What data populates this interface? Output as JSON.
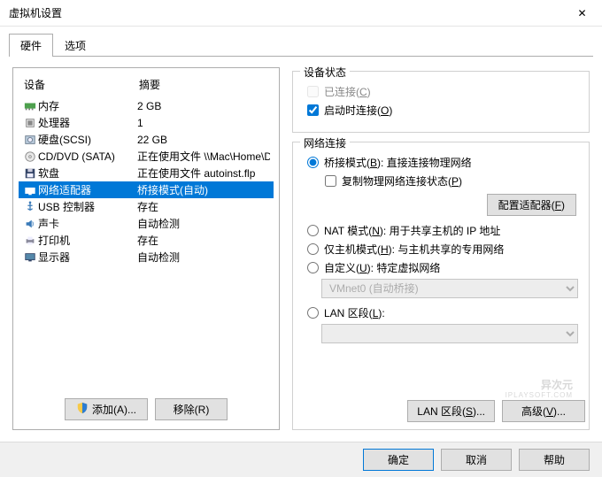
{
  "window": {
    "title": "虚拟机设置",
    "close": "✕"
  },
  "tabs": {
    "hardware": "硬件",
    "options": "选项"
  },
  "hw": {
    "header_device": "设备",
    "header_summary": "摘要",
    "items": [
      {
        "name": "内存",
        "summary": "2 GB",
        "icon": "memory"
      },
      {
        "name": "处理器",
        "summary": "1",
        "icon": "cpu"
      },
      {
        "name": "硬盘(SCSI)",
        "summary": "22 GB",
        "icon": "hdd"
      },
      {
        "name": "CD/DVD (SATA)",
        "summary": "正在使用文件 \\\\Mac\\Home\\D",
        "icon": "cd"
      },
      {
        "name": "软盘",
        "summary": "正在使用文件 autoinst.flp",
        "icon": "floppy"
      },
      {
        "name": "网络适配器",
        "summary": "桥接模式(自动)",
        "icon": "net",
        "selected": true
      },
      {
        "name": "USB 控制器",
        "summary": "存在",
        "icon": "usb"
      },
      {
        "name": "声卡",
        "summary": "自动检测",
        "icon": "sound"
      },
      {
        "name": "打印机",
        "summary": "存在",
        "icon": "printer"
      },
      {
        "name": "显示器",
        "summary": "自动检测",
        "icon": "display"
      }
    ],
    "add_btn": "添加(A)...",
    "remove_btn": "移除(R)"
  },
  "status": {
    "title": "设备状态",
    "connected": "已连接(C)",
    "connect_at_poweron": "启动时连接(O)"
  },
  "net": {
    "title": "网络连接",
    "bridged": "桥接模式(B): 直接连接物理网络",
    "replicate": "复制物理网络连接状态(P)",
    "configure": "配置适配器(F)",
    "nat": "NAT 模式(N): 用于共享主机的 IP 地址",
    "hostonly": "仅主机模式(H): 与主机共享的专用网络",
    "custom": "自定义(U): 特定虚拟网络",
    "custom_value": "VMnet0 (自动桥接)",
    "lan": "LAN 区段(L):",
    "lan_value": "",
    "lan_btn": "LAN 区段(S)...",
    "adv_btn": "高级(V)..."
  },
  "watermark": {
    "big": "异次元",
    "small": "IPLAYSOFT.COM"
  },
  "dialog": {
    "ok": "确定",
    "cancel": "取消",
    "help": "帮助"
  }
}
